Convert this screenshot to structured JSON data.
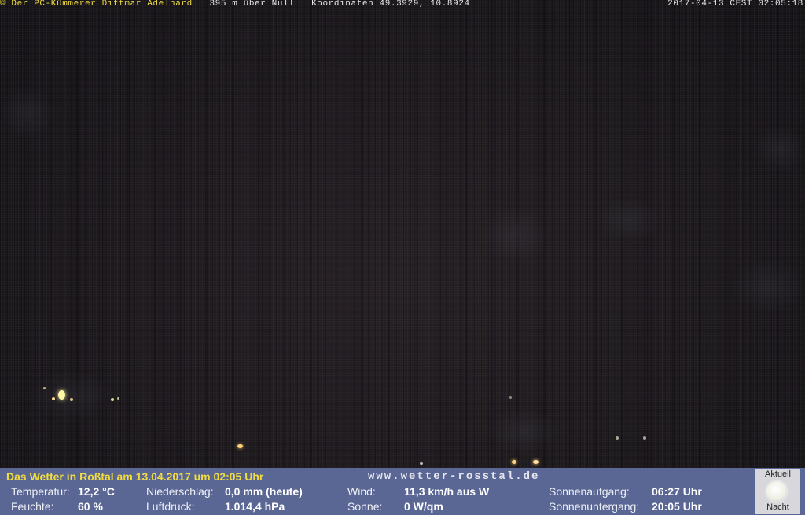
{
  "overlay": {
    "credit": "© Der PC-Kümmerer Dittmar Adelhard",
    "altitude": "395 m über Null",
    "coordinates": "Koordinaten 49.3929, 10.8924",
    "timestamp": "2017-04-13 CEST 02:05:18"
  },
  "weather_bar": {
    "title": "Das Wetter in Roßtal am 13.04.2017 um 02:05 Uhr",
    "website": "www.wetter-rosstal.de",
    "temperature": {
      "label": "Temperatur:",
      "value": "12,2 °C"
    },
    "humidity": {
      "label": "Feuchte:",
      "value": "60 %"
    },
    "precipitation": {
      "label": "Niederschlag:",
      "value": "0,0 mm (heute)"
    },
    "pressure": {
      "label": "Luftdruck:",
      "value": "1.014,4 hPa"
    },
    "wind": {
      "label": "Wind:",
      "value": "11,3 km/h aus W"
    },
    "sun": {
      "label": "Sonne:",
      "value": "0 W/qm"
    },
    "sunrise": {
      "label": "Sonnenaufgang:",
      "value": "06:27 Uhr"
    },
    "sunset": {
      "label": "Sonnenuntergang:",
      "value": "20:05 Uhr"
    }
  },
  "moon_panel": {
    "top_label": "Aktuell",
    "bottom_label": "Nacht",
    "icon": "full-moon-icon"
  },
  "colors": {
    "overlay_text": "#f0dc40",
    "panel_background": "#5a6694",
    "scene_background": "#221d22"
  }
}
